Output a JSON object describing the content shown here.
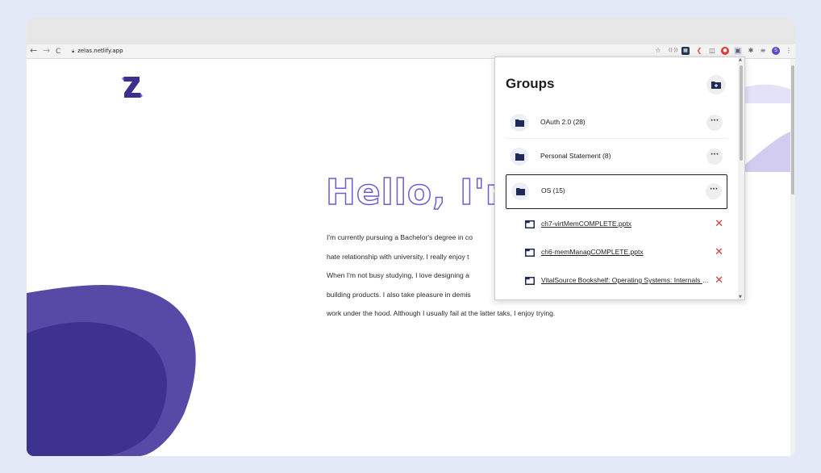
{
  "browser": {
    "url": "zelas.netlify.app",
    "nav": {
      "back": "←",
      "forward": "→",
      "reload": "C"
    }
  },
  "page": {
    "logo_letter": "Z",
    "hello": "Hello, I'm Z",
    "bio_lines": [
      "I'm currently pursuing a Bachelor's degree in co",
      "hate relationship with university, I really enjoy t",
      "When I'm not busy studying, I love designing a",
      "building products. I also take pleasure in demis",
      "work under the hood. Although I usually fail at the latter taks, I enjoy trying."
    ],
    "colors": {
      "primary": "#5b4cc4",
      "dark": "#3d2f8f",
      "outline": "#6c5ecf"
    }
  },
  "popup": {
    "title": "Groups",
    "groups": [
      {
        "label": "OAuth 2.0 (28)"
      },
      {
        "label": "Personal Statement (8)"
      },
      {
        "label": "OS (15)",
        "selected": true
      }
    ],
    "tabs": [
      {
        "label": "ch7-virtMemCOMPLETE.pptx"
      },
      {
        "label": "ch6-memManagCOMPLETE.pptx"
      },
      {
        "label": "VitalSource Bookshelf: Operating Systems: Internals and Design Principles"
      }
    ],
    "more_label": "···",
    "close_label": "✕"
  },
  "extensions": [
    "star-icon",
    "wave-icon",
    "puzzle-app-icon",
    "badge-icon",
    "camera-icon",
    "record-icon",
    "tab-groups-icon",
    "extensions-icon",
    "playlist-icon",
    "profile-avatar",
    "menu-icon"
  ]
}
